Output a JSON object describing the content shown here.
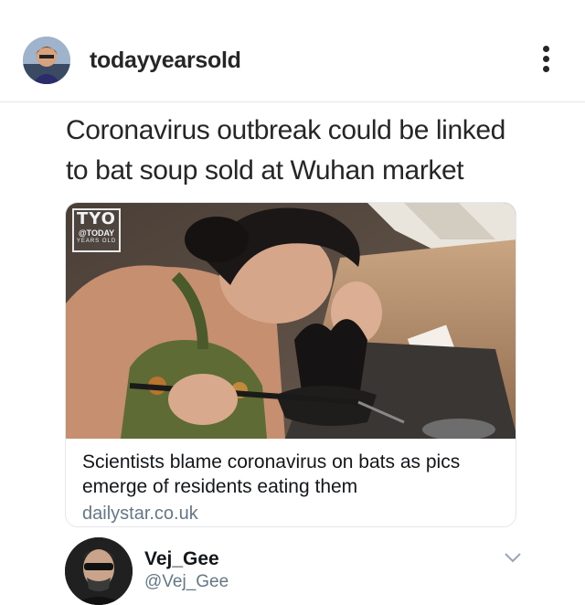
{
  "post": {
    "username": "todayyearsold",
    "avatar_icon": "profile-photo",
    "more_icon": "vertical-ellipsis"
  },
  "tweet": {
    "headline_line1": "Coronavirus outbreak could be linked",
    "headline_line2": "to bat soup sold at Wuhan market"
  },
  "link_card": {
    "logo_main": "TYO",
    "logo_sub": "@TODAY",
    "logo_sub2": "YEARS OLD",
    "title": "Scientists blame coronavirus on bats as pics emerge of residents eating them",
    "domain": "dailystar.co.uk"
  },
  "reply": {
    "name": "Vej_Gee",
    "handle": "@Vej_Gee",
    "chevron_icon": "chevron-down"
  },
  "colors": {
    "text_primary": "#262626",
    "text_secondary": "#657786",
    "divider": "#e6e6e6",
    "card_border": "#e1e8ed"
  }
}
